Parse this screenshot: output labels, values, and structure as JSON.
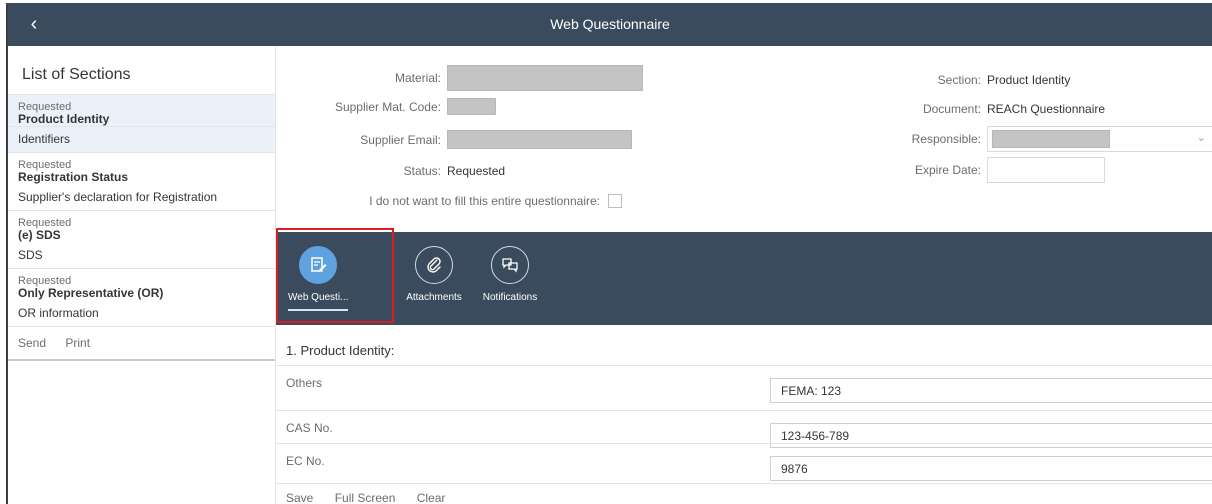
{
  "shell": {
    "title": "Web Questionnaire",
    "back_glyph": "‹"
  },
  "master": {
    "title": "List of Sections",
    "sections": [
      {
        "status": "Requested",
        "name": "Product Identity",
        "sub": "Identifiers"
      },
      {
        "status": "Requested",
        "name": "Registration Status",
        "sub": "Supplier's declaration for Registration"
      },
      {
        "status": "Requested",
        "name": "(e) SDS",
        "sub": "SDS"
      },
      {
        "status": "Requested",
        "name": "Only Representative (OR)",
        "sub": "OR information"
      }
    ],
    "footer": {
      "send": "Send",
      "print": "Print"
    }
  },
  "header": {
    "material_label": "Material:",
    "supplier_mat_code_label": "Supplier Mat. Code:",
    "supplier_email_label": "Supplier Email:",
    "status_label": "Status:",
    "status_value": "Requested",
    "optout_label": "I do not want to fill this entire questionnaire:",
    "section_label": "Section:",
    "section_value": "Product Identity",
    "document_label": "Document:",
    "document_value": "REACh Questionnaire",
    "responsible_label": "Responsible:",
    "expire_label": "Expire Date:"
  },
  "tabs": [
    {
      "label": "Web Questi...",
      "icon": "edit-form-icon"
    },
    {
      "label": "Attachments",
      "icon": "paperclip-icon"
    },
    {
      "label": "Notifications",
      "icon": "chat-bubbles-icon"
    }
  ],
  "questionnaire": {
    "title": "1. Product Identity:",
    "fields": [
      {
        "label": "Others",
        "value": "FEMA: 123"
      },
      {
        "label": "CAS No.",
        "value": "123-456-789"
      },
      {
        "label": "EC No.",
        "value": "9876"
      }
    ],
    "footer": {
      "save": "Save",
      "fullscreen": "Full Screen",
      "clear": "Clear"
    }
  }
}
